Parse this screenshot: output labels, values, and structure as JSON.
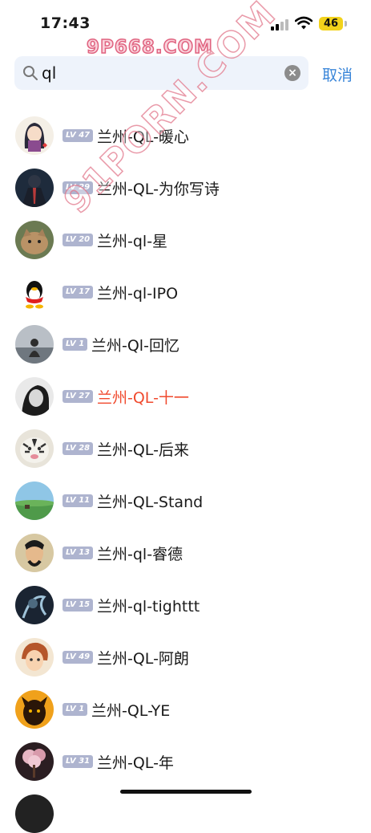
{
  "status_bar": {
    "time": "17:43",
    "battery": "46"
  },
  "watermark": {
    "top": "9P668.COM",
    "diagonal": "91PORN.COM"
  },
  "search": {
    "value": "ql",
    "cancel_label": "取消"
  },
  "results": [
    {
      "level": "LV 47",
      "name": "兰州-QL-暖心",
      "highlight": false,
      "avatar": "anime-girl-avatar"
    },
    {
      "level": "LV 29",
      "name": "兰州-QL-为你写诗",
      "highlight": false,
      "avatar": "suit-man-avatar"
    },
    {
      "level": "LV 20",
      "name": "兰州-ql-星",
      "highlight": false,
      "avatar": "cat-avatar"
    },
    {
      "level": "LV 17",
      "name": "兰州-ql-IPO",
      "highlight": false,
      "avatar": "qq-penguin-avatar"
    },
    {
      "level": "LV 1",
      "name": "兰州-Ql-回忆",
      "highlight": false,
      "avatar": "figure-back-avatar"
    },
    {
      "level": "LV 27",
      "name": "兰州-QL-十一",
      "highlight": true,
      "avatar": "bw-portrait-avatar"
    },
    {
      "level": "LV 28",
      "name": "兰州-QL-后来",
      "highlight": false,
      "avatar": "tiger-avatar"
    },
    {
      "level": "LV 11",
      "name": "兰州-QL-Stand",
      "highlight": false,
      "avatar": "landscape-avatar"
    },
    {
      "level": "LV 13",
      "name": "兰州-ql-睿德",
      "highlight": false,
      "avatar": "warrior-avatar"
    },
    {
      "level": "LV 15",
      "name": "兰州-ql-tighttt",
      "highlight": false,
      "avatar": "dark-art-avatar"
    },
    {
      "level": "LV 49",
      "name": "兰州-QL-阿朗",
      "highlight": false,
      "avatar": "cartoon-boy-avatar"
    },
    {
      "level": "LV 1",
      "name": "兰州-QL-YE",
      "highlight": false,
      "avatar": "dark-creature-avatar"
    },
    {
      "level": "LV 31",
      "name": "兰州-QL-年",
      "highlight": false,
      "avatar": "blossom-tree-avatar"
    }
  ],
  "colors": {
    "highlight": "#f04a2e",
    "badge": "#aeb4cf",
    "accent": "#3a86d9",
    "search_bg": "#eef3fb"
  }
}
